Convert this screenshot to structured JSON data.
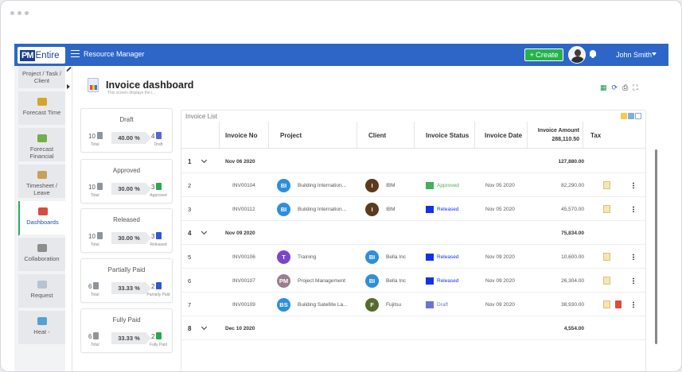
{
  "app": {
    "logo_pm": "PM",
    "logo_text": "Entire",
    "title": "Resource Manager",
    "create_label": "Create",
    "user_name": "John Smith"
  },
  "sidebar": {
    "items": [
      {
        "label": "Project / Task / Client",
        "color": "#c9c9c9"
      },
      {
        "label": "Forecast Time",
        "color": "#d4a52c"
      },
      {
        "label": "Forecast Financial",
        "color": "#6fb04b"
      },
      {
        "label": "Timesheet / Leave",
        "color": "#c8a05b"
      },
      {
        "label": "Dashboards",
        "color": "#d94b3c",
        "active": true
      },
      {
        "label": "Collaboration",
        "color": "#8d8d8d"
      },
      {
        "label": "Request",
        "color": "#b9c2d1"
      },
      {
        "label": "Heat -",
        "color": "#56a0d3"
      }
    ]
  },
  "page": {
    "title": "Invoice dashboard",
    "subtitle": "This screen displays the i..."
  },
  "cards": [
    {
      "title": "Draft",
      "left_num": "10",
      "left_label": "Total",
      "percent": "40.00 %",
      "right_num": "4",
      "right_label": "Draft",
      "right_color": "#5566d9"
    },
    {
      "title": "Approved",
      "left_num": "10",
      "left_label": "Total",
      "percent": "30.00 %",
      "right_num": "3",
      "right_label": "Approved",
      "right_color": "#2aa84e"
    },
    {
      "title": "Released",
      "left_num": "10",
      "left_label": "Total",
      "percent": "30.00 %",
      "right_num": "3",
      "right_label": "Released",
      "right_color": "#2d58d6"
    },
    {
      "title": "Partially Paid",
      "left_num": "6",
      "left_label": "Total",
      "percent": "33.33 %",
      "right_num": "2",
      "right_label": "Partially Paid",
      "right_color": "#2d58d6"
    },
    {
      "title": "Fully Paid",
      "left_num": "6",
      "left_label": "Total",
      "percent": "33.33 %",
      "right_num": "2",
      "right_label": "Fully Paid",
      "right_color": "#2aa84e"
    }
  ],
  "list": {
    "title": "Invoice List",
    "headers": {
      "invoice_no": "Invoice No",
      "project": "Project",
      "client": "Client",
      "status": "Invoice Status",
      "date": "Invoice Date",
      "amount": "Invoice Amount",
      "amount_total": "288,110.50",
      "tax": "Tax"
    },
    "rows": [
      {
        "type": "group",
        "num": "1",
        "date": "Nov 06 2020",
        "amount": "127,880.00"
      },
      {
        "type": "item",
        "num": "2",
        "invoice": "INV00104",
        "proj_initials": "BI",
        "proj_color": "#2e8fd8",
        "project": "Building Internation...",
        "client_initials": "I",
        "client_color": "#5b3a1d",
        "client": "IBM",
        "status": "Approved",
        "status_color": "#43b05c",
        "date": "Nov 05 2020",
        "amount": "82,290.00",
        "trash": false
      },
      {
        "type": "item",
        "num": "3",
        "invoice": "INV00112",
        "proj_initials": "BI",
        "proj_color": "#2e8fd8",
        "project": "Building Internation...",
        "client_initials": "I",
        "client_color": "#5b3a1d",
        "client": "IBM",
        "status": "Released",
        "status_color": "#1133e6",
        "date": "Nov 05 2020",
        "amount": "45,570.00",
        "trash": false
      },
      {
        "type": "group",
        "num": "4",
        "date": "Nov 09 2020",
        "amount": "75,834.00"
      },
      {
        "type": "item",
        "num": "5",
        "invoice": "INV00106",
        "proj_initials": "T",
        "proj_color": "#7c45c8",
        "project": "Training",
        "client_initials": "BI",
        "client_color": "#2e8fd8",
        "client": "Bella Inc",
        "status": "Released",
        "status_color": "#1133e6",
        "date": "Nov 09 2020",
        "amount": "10,600.00",
        "trash": false
      },
      {
        "type": "item",
        "num": "6",
        "invoice": "INV00107",
        "proj_initials": "PM",
        "proj_color": "#9a7d8f",
        "project": "Project Management",
        "client_initials": "BI",
        "client_color": "#2e8fd8",
        "client": "Bella Inc",
        "status": "Released",
        "status_color": "#1133e6",
        "date": "Nov 09 2020",
        "amount": "26,304.00",
        "trash": false
      },
      {
        "type": "item",
        "num": "7",
        "invoice": "INV00109",
        "proj_initials": "BS",
        "proj_color": "#2e8fd8",
        "project": "Building Satellite La...",
        "client_initials": "F",
        "client_color": "#556b2f",
        "client": "Fujitsu",
        "status": "Draft",
        "status_color": "#6b73db",
        "date": "Nov 09 2020",
        "amount": "38,930.00",
        "trash": true
      },
      {
        "type": "group",
        "num": "8",
        "date": "Dec 10 2020",
        "amount": "4,554.00"
      }
    ]
  }
}
